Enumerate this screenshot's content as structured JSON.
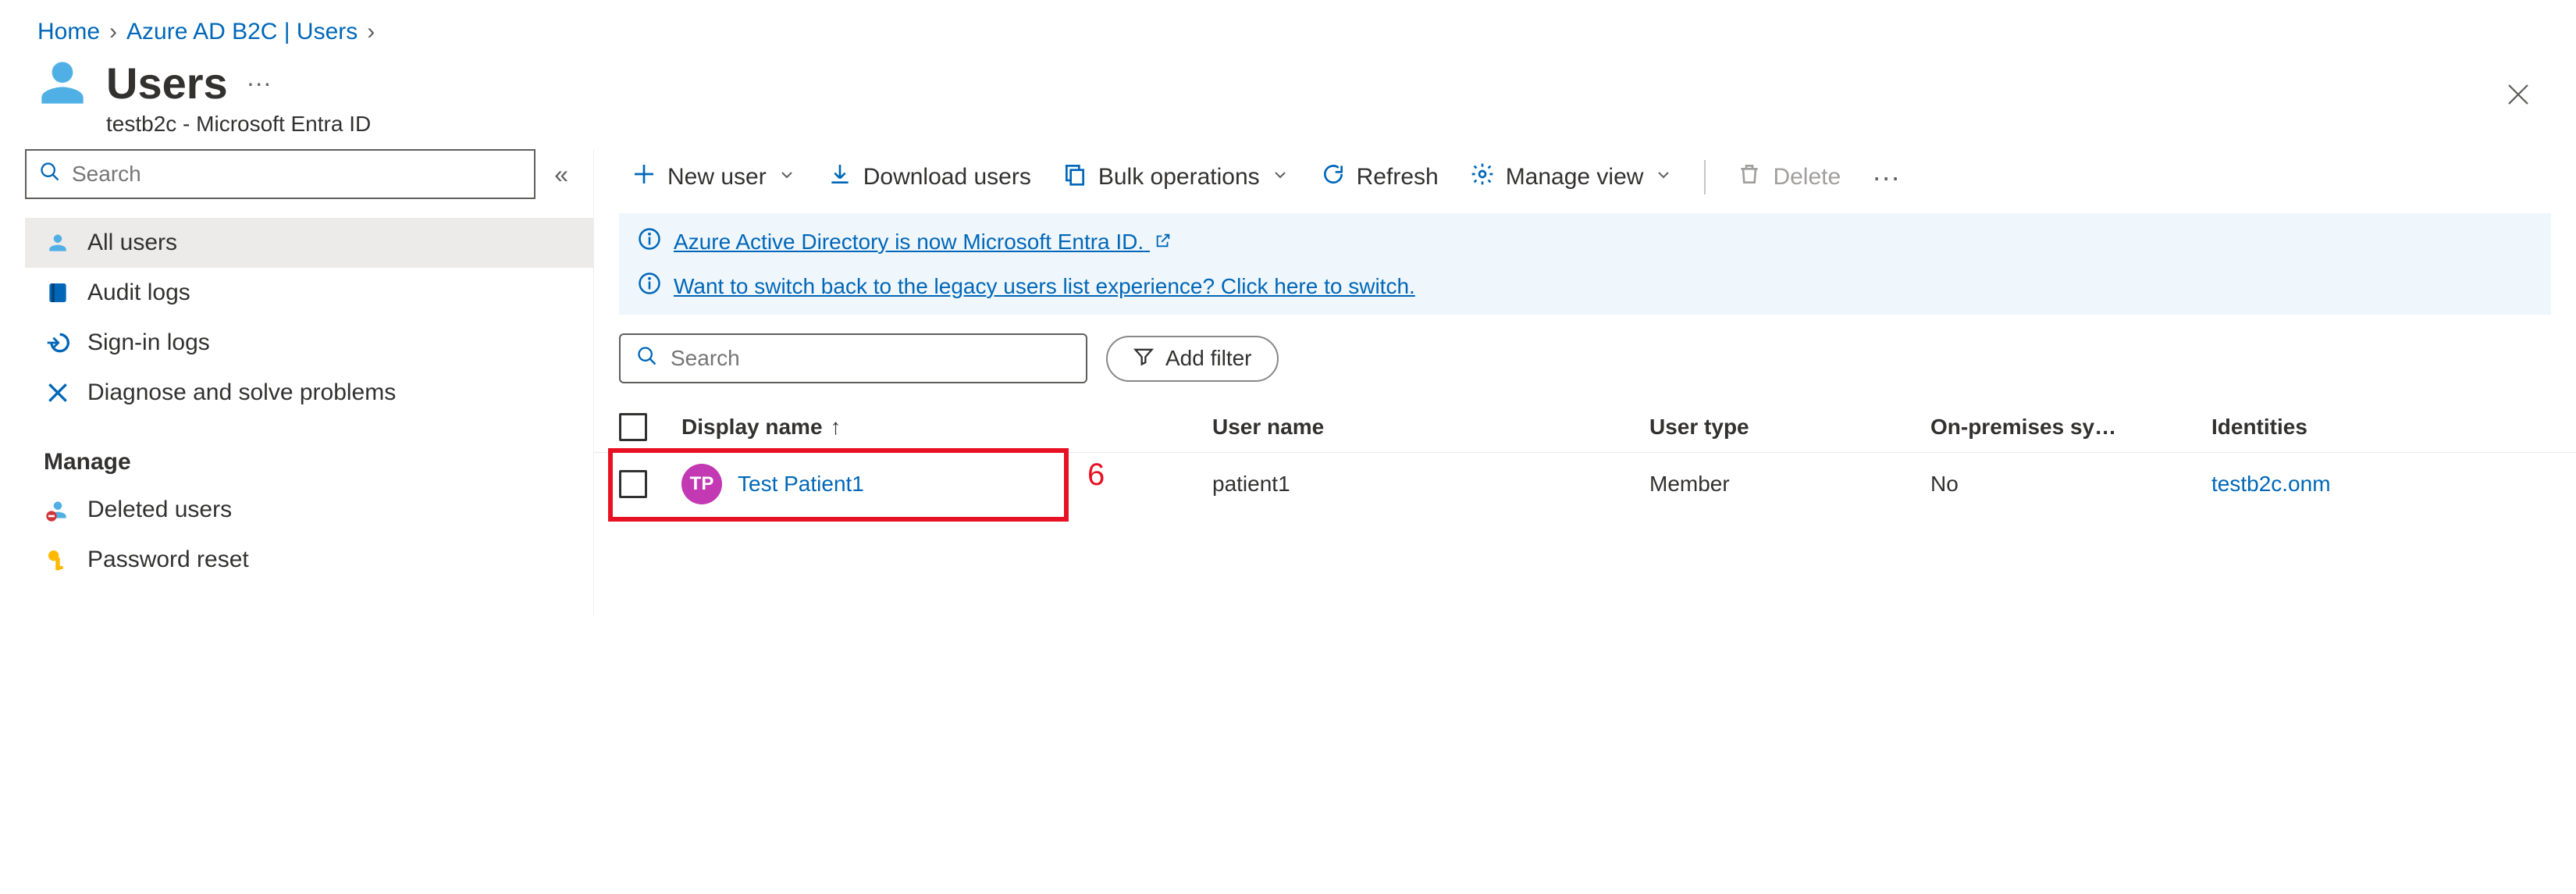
{
  "breadcrumb": {
    "home": "Home",
    "second": "Azure AD B2C | Users"
  },
  "header": {
    "title": "Users",
    "more": "···",
    "subtitle": "testb2c - Microsoft Entra ID"
  },
  "sidebar": {
    "search_placeholder": "Search",
    "items": [
      {
        "label": "All users"
      },
      {
        "label": "Audit logs"
      },
      {
        "label": "Sign-in logs"
      },
      {
        "label": "Diagnose and solve problems"
      }
    ],
    "manage_label": "Manage",
    "manage_items": [
      {
        "label": "Deleted users"
      },
      {
        "label": "Password reset"
      }
    ]
  },
  "toolbar": {
    "new_user": "New user",
    "download_users": "Download users",
    "bulk_ops": "Bulk operations",
    "refresh": "Refresh",
    "manage_view": "Manage view",
    "delete": "Delete",
    "more": "···"
  },
  "info": {
    "line1": "Azure Active Directory is now Microsoft Entra ID.",
    "line2": "Want to switch back to the legacy users list experience? Click here to switch."
  },
  "filter": {
    "search_placeholder": "Search",
    "add_filter": "Add filter"
  },
  "columns": {
    "display_name": "Display name",
    "user_name": "User name",
    "user_type": "User type",
    "on_prem": "On-premises sy…",
    "identities": "Identities"
  },
  "rows": [
    {
      "initials": "TP",
      "display_name": "Test Patient1",
      "user_name": "patient1",
      "user_type": "Member",
      "on_prem": "No",
      "identities": "testb2c.onm"
    }
  ],
  "annotation": {
    "number": "6"
  }
}
